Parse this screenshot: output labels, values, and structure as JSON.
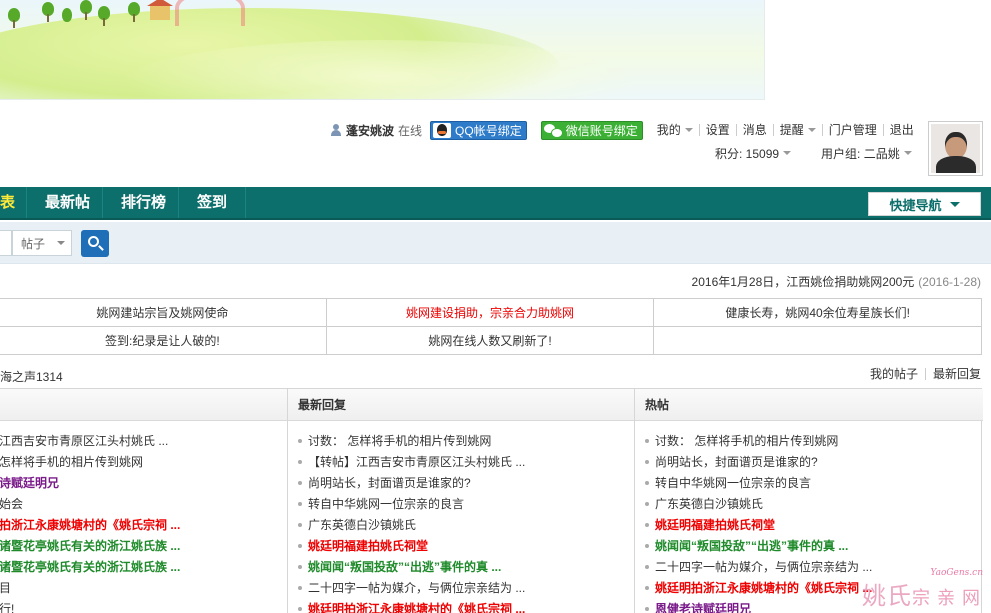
{
  "user": {
    "name": "蓬安姚波",
    "status": "在线",
    "qq_bind": "QQ帐号绑定",
    "wechat_bind": "微信账号绑定",
    "menu": [
      "我的",
      "设置",
      "消息",
      "提醒",
      "门户管理",
      "退出"
    ],
    "points": "积分: 15099",
    "group": "用户组: 二品姚"
  },
  "nav": {
    "items": [
      "表",
      "最新帖",
      "排行榜",
      "签到"
    ],
    "quick_nav": "快捷导航"
  },
  "search": {
    "type": "帖子"
  },
  "announcement": {
    "text": "2016年1月28日，江西姚俭捐助姚网200元",
    "date": "(2016-1-28)"
  },
  "links": [
    [
      "姚网建站宗旨及姚网使命",
      "姚网建设捐助，宗亲合力助姚网",
      "健康长寿，姚网40余位寿星族长们!"
    ],
    [
      "签到:纪录是让人破的!",
      "姚网在线人数又刷新了!",
      ""
    ]
  ],
  "section": {
    "left": "海之声1314",
    "right_links": [
      "我的帖子",
      "最新回复"
    ]
  },
  "columns": [
    {
      "title": "",
      "rows": [
        {
          "text": "江西吉安市青原区江头村姚氏 ...",
          "style": "normal"
        },
        {
          "text": "怎样将手机的相片传到姚网",
          "style": "normal"
        },
        {
          "text": "诗赋廷明兄",
          "style": "purple"
        },
        {
          "text": "始会",
          "style": "normal"
        },
        {
          "text": "拍浙江永康姚塘村的《姚氏宗祠 ...",
          "style": "red"
        },
        {
          "text": "诸暨花亭姚氏有关的浙江姚氏族 ...",
          "style": "green"
        },
        {
          "text": "诸暨花亭姚氏有关的浙江姚氏族 ...",
          "style": "green"
        },
        {
          "text": "目",
          "style": "normal"
        },
        {
          "text": "行!",
          "style": "normal"
        }
      ]
    },
    {
      "title": "最新回复",
      "rows": [
        {
          "text": "讨数： 怎样将手机的相片传到姚网",
          "style": "normal"
        },
        {
          "text": "【转帖】江西吉安市青原区江头村姚氏 ...",
          "style": "normal"
        },
        {
          "text": "尚明站长，封面谱页是谁家的?",
          "style": "normal"
        },
        {
          "text": "转自中华姚网一位宗亲的良言",
          "style": "normal"
        },
        {
          "text": "广东英德白沙镇姚氏",
          "style": "normal"
        },
        {
          "text": "姚廷明福建拍姚氏祠堂",
          "style": "red"
        },
        {
          "text": "姚闻闻“叛国投敌”“出逃”事件的真 ...",
          "style": "green"
        },
        {
          "text": "二十四字一帖为媒介，与俩位宗亲结为 ...",
          "style": "normal"
        },
        {
          "text": "姚廷明拍浙江永康姚塘村的《姚氏宗祠 ...",
          "style": "red"
        }
      ]
    },
    {
      "title": "热帖",
      "rows": [
        {
          "text": "讨数： 怎样将手机的相片传到姚网",
          "style": "normal"
        },
        {
          "text": "尚明站长，封面谱页是谁家的?",
          "style": "normal"
        },
        {
          "text": "转自中华姚网一位宗亲的良言",
          "style": "normal"
        },
        {
          "text": "广东英德白沙镇姚氏",
          "style": "normal"
        },
        {
          "text": "姚廷明福建拍姚氏祠堂",
          "style": "red"
        },
        {
          "text": "姚闻闻“叛国投敌”“出逃”事件的真 ...",
          "style": "green"
        },
        {
          "text": "二十四字一帖为媒介，与俩位宗亲结为 ...",
          "style": "normal"
        },
        {
          "text": "姚廷明拍浙江永康姚塘村的《姚氏宗祠 ...",
          "style": "red"
        },
        {
          "text": "恩健老诗赋廷明兄",
          "style": "purple"
        }
      ]
    }
  ],
  "watermark": {
    "small": "YaoGens.cn",
    "big": "姚氏",
    "big2": "宗亲网"
  }
}
